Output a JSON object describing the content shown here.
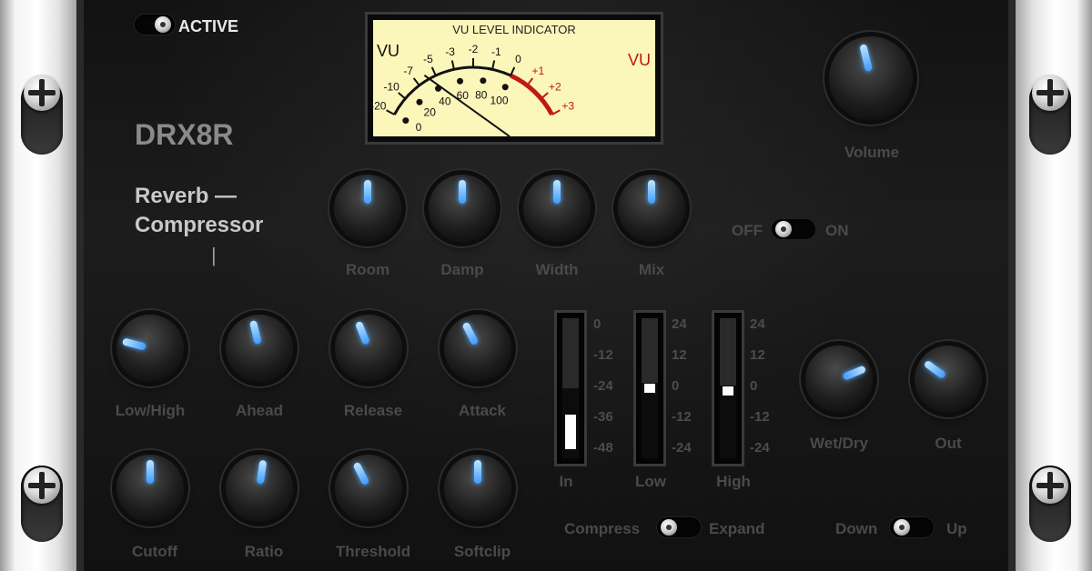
{
  "active": {
    "label": "ACTIVE"
  },
  "brand": {
    "model": "DRX8R",
    "subtitle_line1": "Reverb —",
    "subtitle_line2": "Compressor",
    "subtitle_line3": "|"
  },
  "vu_meter": {
    "title": "VU LEVEL INDICATOR",
    "vu_left": "VU",
    "vu_right": "VU",
    "db_labels": [
      "-20",
      "-10",
      "-7",
      "-5",
      "-3",
      "-2",
      "-1",
      "0",
      "+1",
      "+2",
      "+3"
    ],
    "percent_labels": [
      "0",
      "20",
      "40",
      "60",
      "80",
      "100"
    ],
    "needle_value_db": -6,
    "colors": {
      "face": "#fbf6b9",
      "red_zone": "#c01818"
    }
  },
  "volume": {
    "label": "Volume",
    "value_fraction": 0.45
  },
  "reverb_knobs": [
    {
      "label": "Room",
      "value_fraction": 0.5
    },
    {
      "label": "Damp",
      "value_fraction": 0.5
    },
    {
      "label": "Width",
      "value_fraction": 0.5
    },
    {
      "label": "Mix",
      "value_fraction": 0.5
    }
  ],
  "reverb_switch": {
    "off_label": "OFF",
    "on_label": "ON",
    "state": "off"
  },
  "comp_knobs_row1": [
    {
      "label": "Low/High",
      "value_fraction": 0.22
    },
    {
      "label": "Ahead",
      "value_fraction": 0.45
    },
    {
      "label": "Release",
      "value_fraction": 0.42
    },
    {
      "label": "Attack",
      "value_fraction": 0.4
    }
  ],
  "comp_knobs_row2": [
    {
      "label": "Cutoff",
      "value_fraction": 0.5
    },
    {
      "label": "Ratio",
      "value_fraction": 0.53
    },
    {
      "label": "Threshold",
      "value_fraction": 0.4
    },
    {
      "label": "Softclip",
      "value_fraction": 0.5
    }
  ],
  "meters": {
    "in": {
      "label": "In",
      "scale": [
        "0",
        "-12",
        "-24",
        "-36",
        "-48"
      ],
      "fill_fraction": 0.5,
      "level_fraction": 0.28
    },
    "low": {
      "label": "Low",
      "scale": [
        "24",
        "12",
        "0",
        "-12",
        "-24"
      ],
      "fill_fraction": 0.54,
      "level_fraction": 0.53
    },
    "high": {
      "label": "High",
      "scale": [
        "24",
        "12",
        "0",
        "-12",
        "-24"
      ],
      "fill_fraction": 0.52,
      "level_fraction": 0.51
    }
  },
  "output_knobs": [
    {
      "label": "Wet/Dry",
      "value_fraction": 0.75
    },
    {
      "label": "Out",
      "value_fraction": 0.3
    }
  ],
  "compress_switch": {
    "left_label": "Compress",
    "right_label": "Expand",
    "state": "compress"
  },
  "direction_switch": {
    "left_label": "Down",
    "right_label": "Up",
    "state": "down"
  }
}
